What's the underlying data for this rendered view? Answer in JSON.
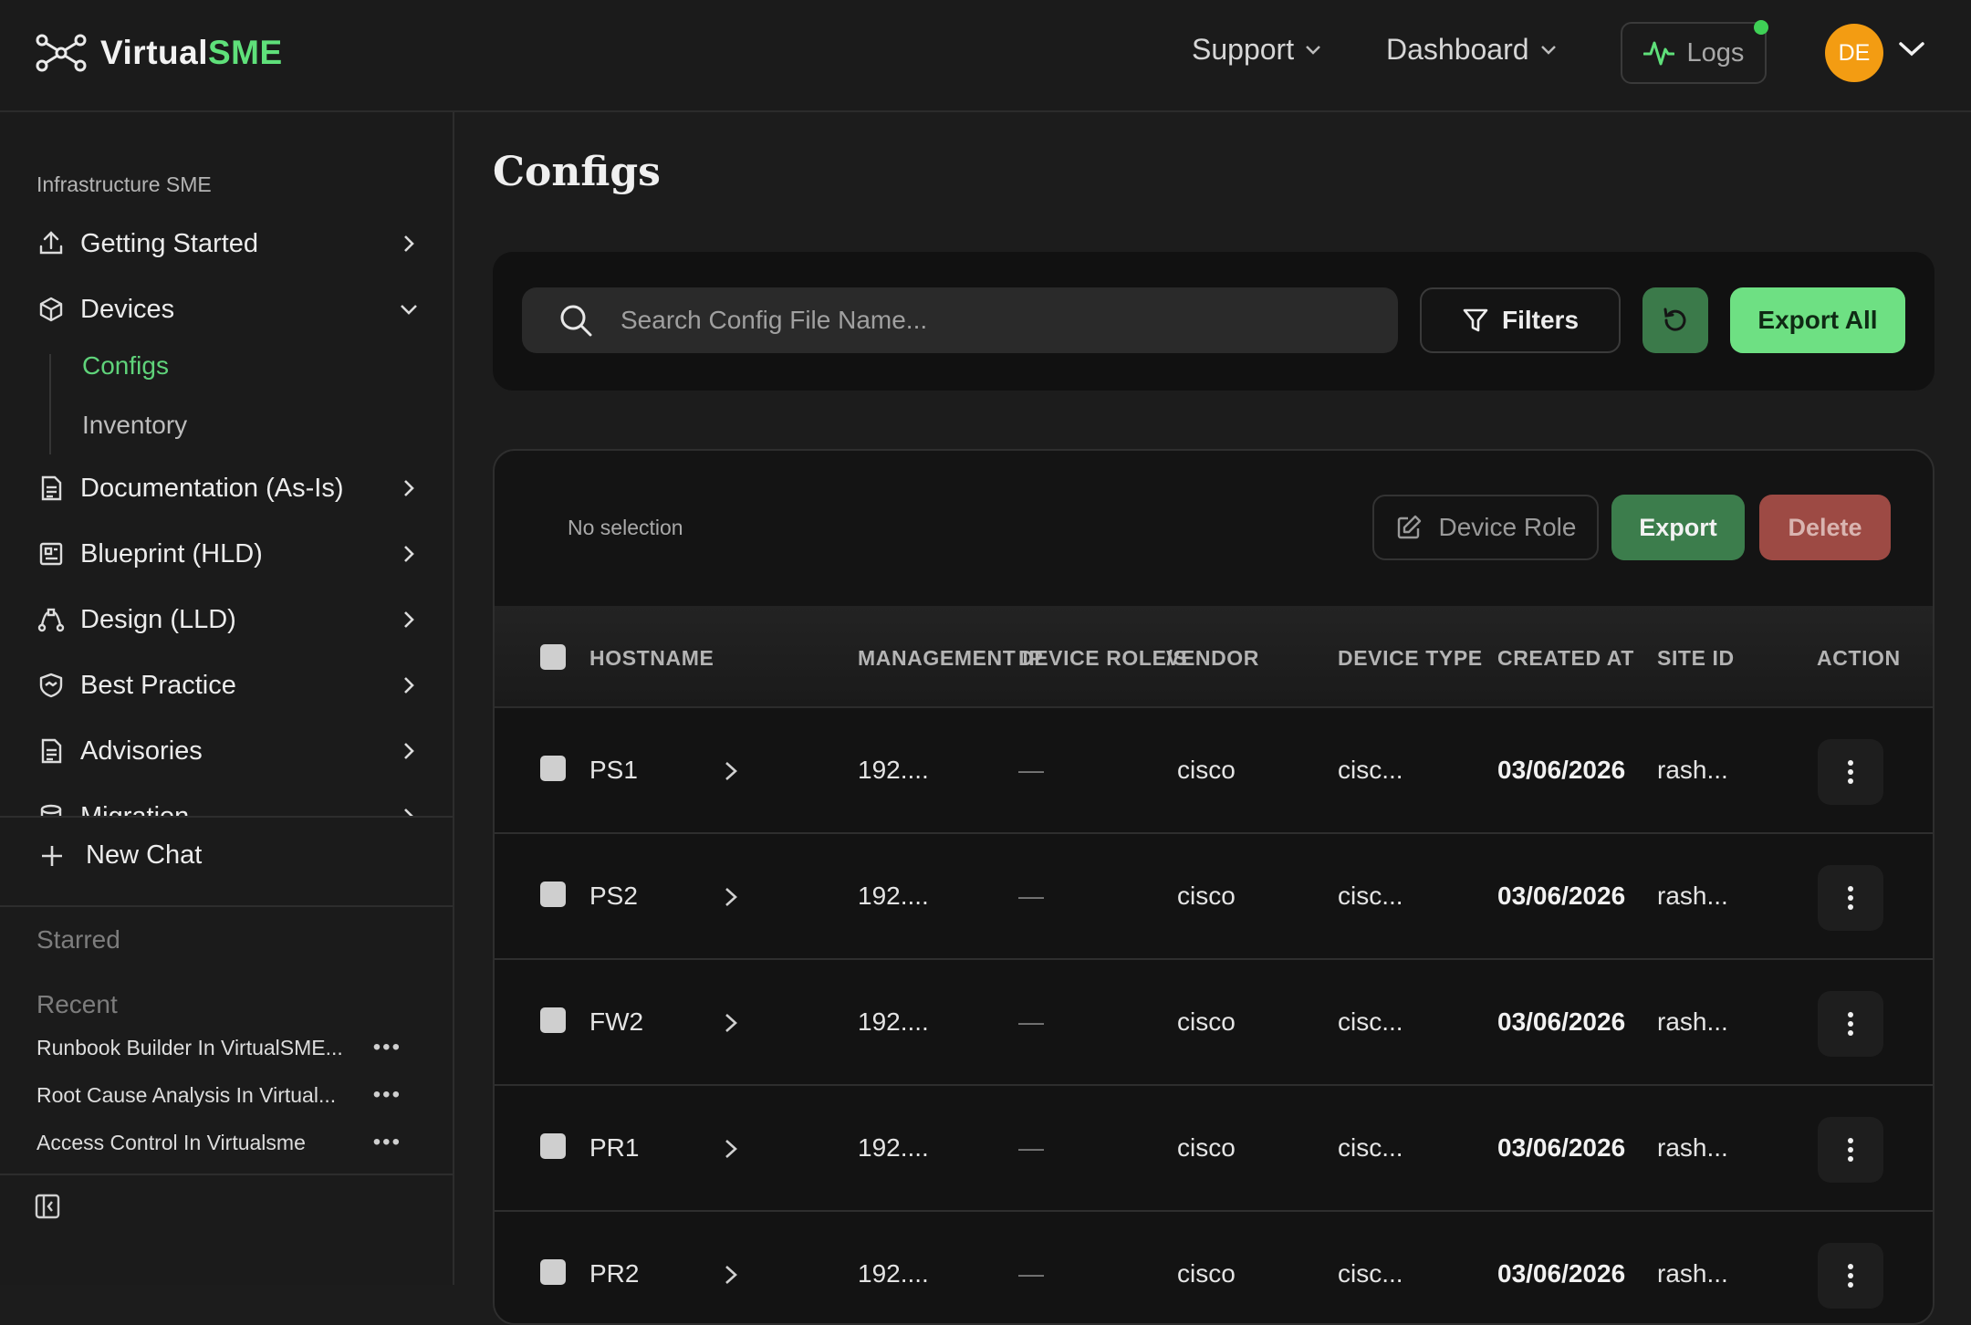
{
  "header": {
    "logo_main": "Virtual",
    "logo_accent": "SME",
    "support_label": "Support",
    "dashboard_label": "Dashboard",
    "logs_label": "Logs",
    "avatar_initials": "DE"
  },
  "sidebar": {
    "section_label": "Infrastructure SME",
    "items": [
      {
        "label": "Getting Started",
        "icon": "upload-icon"
      },
      {
        "label": "Devices",
        "icon": "cube-icon"
      },
      {
        "label": "Documentation (As-Is)",
        "icon": "document-icon"
      },
      {
        "label": "Blueprint (HLD)",
        "icon": "blueprint-icon"
      },
      {
        "label": "Design (LLD)",
        "icon": "vector-design-icon"
      },
      {
        "label": "Best Practice",
        "icon": "shield-handshake-icon"
      },
      {
        "label": "Advisories",
        "icon": "advisory-document-icon"
      },
      {
        "label": "Migration",
        "icon": "database-icon"
      }
    ],
    "sub_items": [
      {
        "label": "Configs",
        "active": true
      },
      {
        "label": "Inventory",
        "active": false
      }
    ],
    "new_chat_label": "New Chat",
    "starred_label": "Starred",
    "recent_label": "Recent",
    "recent_items": [
      "Runbook Builder In VirtualSME...",
      "Root Cause Analysis In Virtual...",
      "Access Control In Virtualsme"
    ],
    "more_glyph": "•••"
  },
  "main": {
    "title": "Configs",
    "search_placeholder": "Search Config File Name...",
    "filters_label": "Filters",
    "export_all_label": "Export All",
    "no_selection": "No selection",
    "device_role_label": "Device Role",
    "export_label": "Export",
    "delete_label": "Delete",
    "columns": [
      "HOSTNAME",
      "MANAGEMENT IP",
      "DEVICE ROLE/S",
      "VENDOR",
      "DEVICE TYPE",
      "CREATED AT",
      "SITE ID",
      "ACTION"
    ],
    "rows": [
      {
        "hostname": "PS1",
        "ip": "192....",
        "role": "—",
        "vendor": "cisco",
        "type": "cisc...",
        "created": "03/06/2026",
        "site": "rash..."
      },
      {
        "hostname": "PS2",
        "ip": "192....",
        "role": "—",
        "vendor": "cisco",
        "type": "cisc...",
        "created": "03/06/2026",
        "site": "rash..."
      },
      {
        "hostname": "FW2",
        "ip": "192....",
        "role": "—",
        "vendor": "cisco",
        "type": "cisc...",
        "created": "03/06/2026",
        "site": "rash..."
      },
      {
        "hostname": "PR1",
        "ip": "192....",
        "role": "—",
        "vendor": "cisco",
        "type": "cisc...",
        "created": "03/06/2026",
        "site": "rash..."
      },
      {
        "hostname": "PR2",
        "ip": "192....",
        "role": "—",
        "vendor": "cisco",
        "type": "cisc...",
        "created": "03/06/2026",
        "site": "rash..."
      }
    ]
  },
  "colors": {
    "accent_green": "#5fe07a",
    "active_link": "#5fd37a",
    "delete_red": "#9d4a44",
    "avatar": "#f39c12",
    "status_dot": "#3fd056"
  }
}
